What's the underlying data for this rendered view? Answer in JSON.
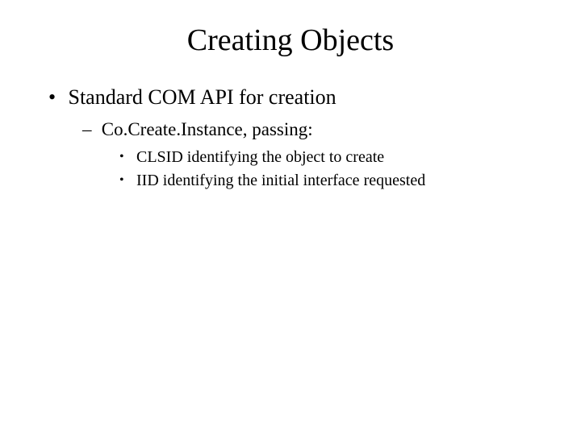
{
  "title": "Creating Objects",
  "bullets": {
    "l1": "Standard COM API for creation",
    "l2": "Co.Create.Instance, passing:",
    "l3a": "CLSID identifying the object to create",
    "l3b": "IID identifying the initial interface requested"
  }
}
